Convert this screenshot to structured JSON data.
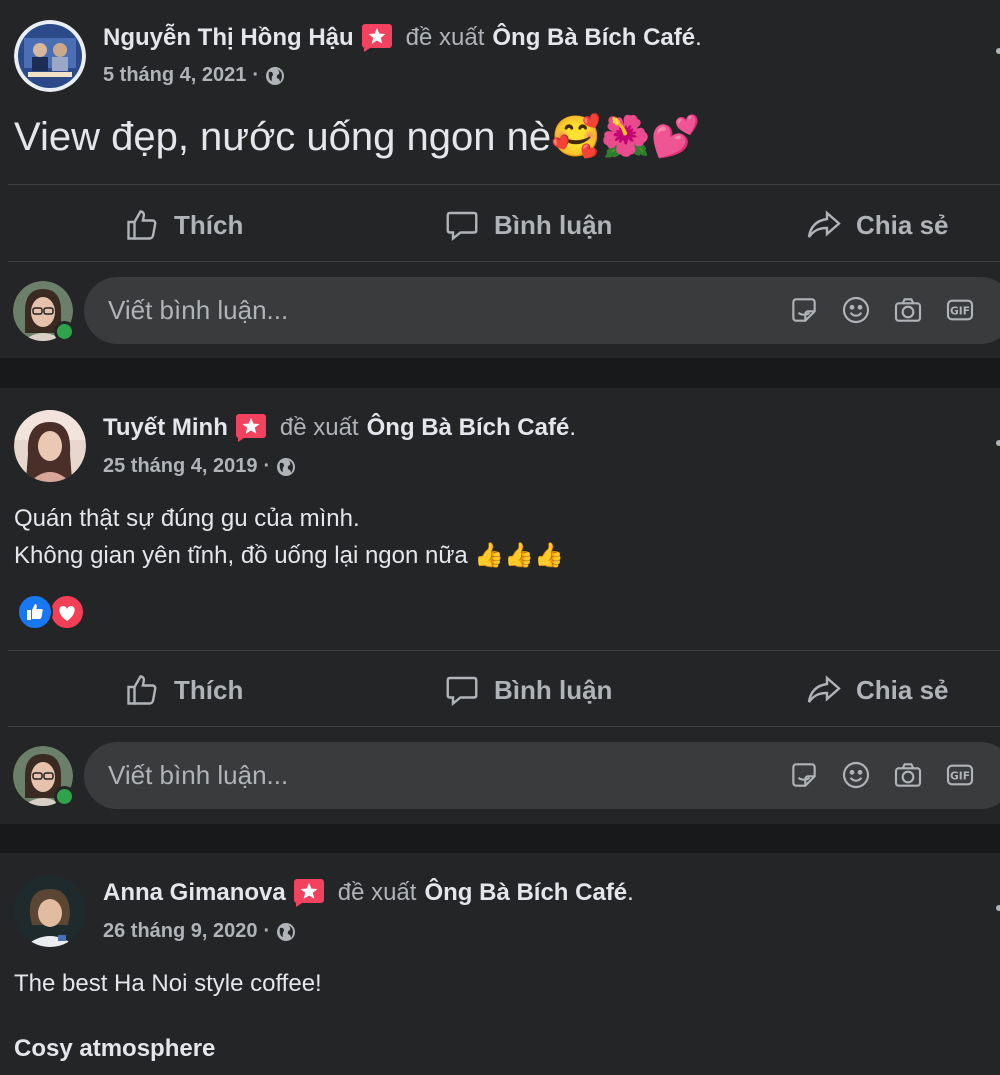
{
  "verb_text": "đề xuất",
  "page_name": "Ông Bà Bích Café",
  "period": ".",
  "date_sep": "·",
  "actions": {
    "like": "Thích",
    "comment": "Bình luận",
    "share": "Chia sẻ"
  },
  "comment_placeholder": "Viết bình luận...",
  "icons": {
    "recommend_badge": "recommend-flag-icon",
    "privacy": "globe-icon",
    "like": "thumbs-up-icon",
    "comment": "speech-bubble-icon",
    "share": "share-arrow-icon",
    "sticker": "sticker-icon",
    "emoji": "smiley-icon",
    "photo": "camera-icon",
    "gif": "gif-icon",
    "reaction_like": "like-reaction-icon",
    "reaction_love": "love-reaction-icon"
  },
  "colors": {
    "background": "#18191a",
    "card": "#242526",
    "input": "#3a3b3c",
    "text_primary": "#e4e6eb",
    "text_secondary": "#b0b3b8",
    "badge": "#f3425f",
    "online": "#31a24c",
    "like_blue": "#1877f2"
  },
  "posts": [
    {
      "author": "Nguyễn Thị Hồng Hậu",
      "date": "5 tháng 4, 2021",
      "text_lines": [
        "View đẹp, nước uống ngon nè🥰🌺💕"
      ]
    },
    {
      "author": "Tuyết Minh",
      "date": "25 tháng 4, 2019",
      "text_lines": [
        "Quán thật sự đúng gu của mình.",
        "Không gian yên tĩnh, đồ uống lại ngon nữa 👍👍👍"
      ]
    },
    {
      "author": "Anna Gimanova",
      "date": "26 tháng 9, 2020",
      "text_lines": [
        "The best Ha Noi style coffee!",
        "Cosy atmosphere"
      ]
    }
  ]
}
